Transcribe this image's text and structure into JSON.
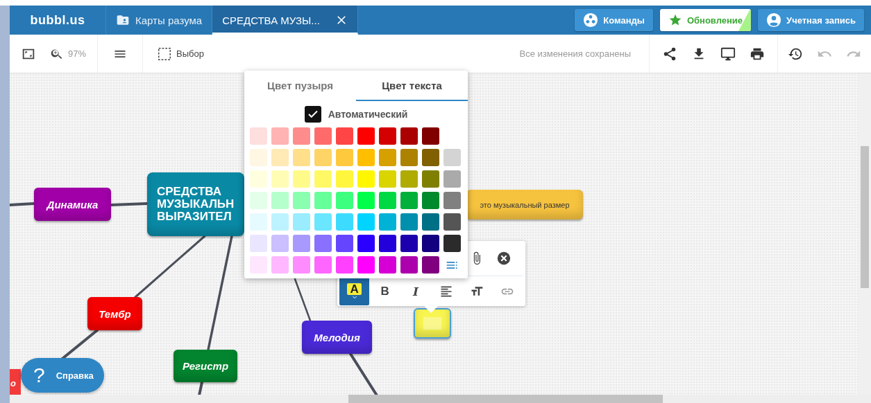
{
  "topbar": {
    "logo": "bubbl.us",
    "tabs": [
      {
        "kind": "folder",
        "label": "Карты разума",
        "selected": false
      },
      {
        "kind": "map",
        "label": "СРЕДСТВА МУЗЫ...",
        "selected": true
      }
    ],
    "buttons": [
      {
        "kind": "teams",
        "label": "Команды"
      },
      {
        "kind": "upgrade",
        "label": "Обновление"
      },
      {
        "kind": "account",
        "label": "Учетная запись"
      }
    ]
  },
  "toolbar": {
    "zoom": "97%",
    "select": "Выбор",
    "status": "Все изменения сохранены",
    "actions": [
      {
        "kind": "share",
        "disabled": false
      },
      {
        "kind": "download",
        "disabled": false
      },
      {
        "kind": "present",
        "disabled": false
      },
      {
        "kind": "print",
        "disabled": false
      },
      {
        "kind": "history",
        "disabled": false
      },
      {
        "kind": "undo",
        "disabled": true
      },
      {
        "kind": "redo",
        "disabled": true
      }
    ]
  },
  "nodes": [
    {
      "kind": "topic",
      "lines": [
        "Динамика"
      ],
      "color": "#a100a8",
      "selected": false
    },
    {
      "kind": "central",
      "lines": [
        "СРЕДСТВА",
        "МУЗЫКАЛЬН",
        "ВЫРАЗИТЕЛ"
      ],
      "color": "#0a89a5",
      "selected": false
    },
    {
      "kind": "note",
      "lines": [
        "это музыкальный размер"
      ],
      "color": "#f6c33f",
      "selected": false
    },
    {
      "kind": "topic",
      "lines": [
        "Тембр"
      ],
      "color": "#f50000",
      "selected": false
    },
    {
      "kind": "empty",
      "color": "#f8f550",
      "selected": true
    },
    {
      "kind": "topic",
      "lines": [
        "Мелодия"
      ],
      "color": "#4a2ad8",
      "selected": false
    },
    {
      "kind": "topic",
      "lines": [
        "Регистр"
      ],
      "color": "#03852f",
      "selected": false
    },
    {
      "kind": "topic",
      "lines": [
        "о"
      ],
      "color": "#f23a3a",
      "selected": false
    }
  ],
  "color_popup": {
    "tabs": [
      {
        "label": "Цвет пузыря",
        "selected": false
      },
      {
        "label": "Цвет текста",
        "selected": true
      }
    ],
    "auto": {
      "label": "Автоматический",
      "checked": true
    },
    "swatches": [
      [
        {
          "color": "#ffdede"
        },
        {
          "color": "#ffb3b3"
        },
        {
          "color": "#ff8c8c"
        },
        {
          "color": "#ff6b6b"
        },
        {
          "color": "#ff4545"
        },
        {
          "color": "#ff0000"
        },
        {
          "color": "#d40000"
        },
        {
          "color": "#aa0000"
        },
        {
          "color": "#800000"
        }
      ],
      [
        {
          "color": "#fff6e3"
        },
        {
          "color": "#ffe9b5"
        },
        {
          "color": "#ffdf8a"
        },
        {
          "color": "#ffd466"
        },
        {
          "color": "#ffc93d"
        },
        {
          "color": "#ffbf00"
        },
        {
          "color": "#d6a000"
        },
        {
          "color": "#ad8200"
        },
        {
          "color": "#806000"
        },
        {
          "color": "#d4d4d4"
        }
      ],
      [
        {
          "color": "#ffffe0"
        },
        {
          "color": "#fffdb5"
        },
        {
          "color": "#fffb8a"
        },
        {
          "color": "#fff966"
        },
        {
          "color": "#fff63d"
        },
        {
          "color": "#fff700"
        },
        {
          "color": "#dad500"
        },
        {
          "color": "#afab00"
        },
        {
          "color": "#808000"
        },
        {
          "color": "#aaaaaa"
        }
      ],
      [
        {
          "color": "#e3ffe9"
        },
        {
          "color": "#b5ffcc"
        },
        {
          "color": "#8affb0"
        },
        {
          "color": "#66ff99"
        },
        {
          "color": "#3dff7f"
        },
        {
          "color": "#00ff4a"
        },
        {
          "color": "#00d944"
        },
        {
          "color": "#00b03a"
        },
        {
          "color": "#008a2e"
        },
        {
          "color": "#808080"
        }
      ],
      [
        {
          "color": "#e6fbff"
        },
        {
          "color": "#bdf3ff"
        },
        {
          "color": "#99edff"
        },
        {
          "color": "#6be6ff"
        },
        {
          "color": "#3ddcff"
        },
        {
          "color": "#00d4ff"
        },
        {
          "color": "#00b3d6"
        },
        {
          "color": "#008fad"
        },
        {
          "color": "#007087"
        },
        {
          "color": "#555555"
        }
      ],
      [
        {
          "color": "#ebe6ff"
        },
        {
          "color": "#cbbfff"
        },
        {
          "color": "#a899ff"
        },
        {
          "color": "#8a70ff"
        },
        {
          "color": "#6645ff"
        },
        {
          "color": "#2b00ff"
        },
        {
          "color": "#2300d9"
        },
        {
          "color": "#1c00ad"
        },
        {
          "color": "#130080"
        },
        {
          "color": "#2b2b2b"
        }
      ],
      [
        {
          "color": "#ffe6ff"
        },
        {
          "color": "#ffb8ff"
        },
        {
          "color": "#ff8cff"
        },
        {
          "color": "#ff66ff"
        },
        {
          "color": "#ff40ff"
        },
        {
          "color": "#ff00ff"
        },
        {
          "color": "#d600d6"
        },
        {
          "color": "#ad00ad"
        },
        {
          "color": "#800080"
        }
      ]
    ]
  },
  "format_bar": {
    "buttons": [
      {
        "kind": "text-color",
        "glyph": "A",
        "selected": true
      },
      {
        "kind": "bold",
        "glyph": "B",
        "selected": false
      },
      {
        "kind": "italic",
        "glyph": "I",
        "selected": false
      },
      {
        "kind": "align",
        "selected": false
      },
      {
        "kind": "size",
        "selected": false
      },
      {
        "kind": "link",
        "selected": false
      }
    ]
  },
  "help": {
    "glyph": "?",
    "label": "Справка"
  }
}
